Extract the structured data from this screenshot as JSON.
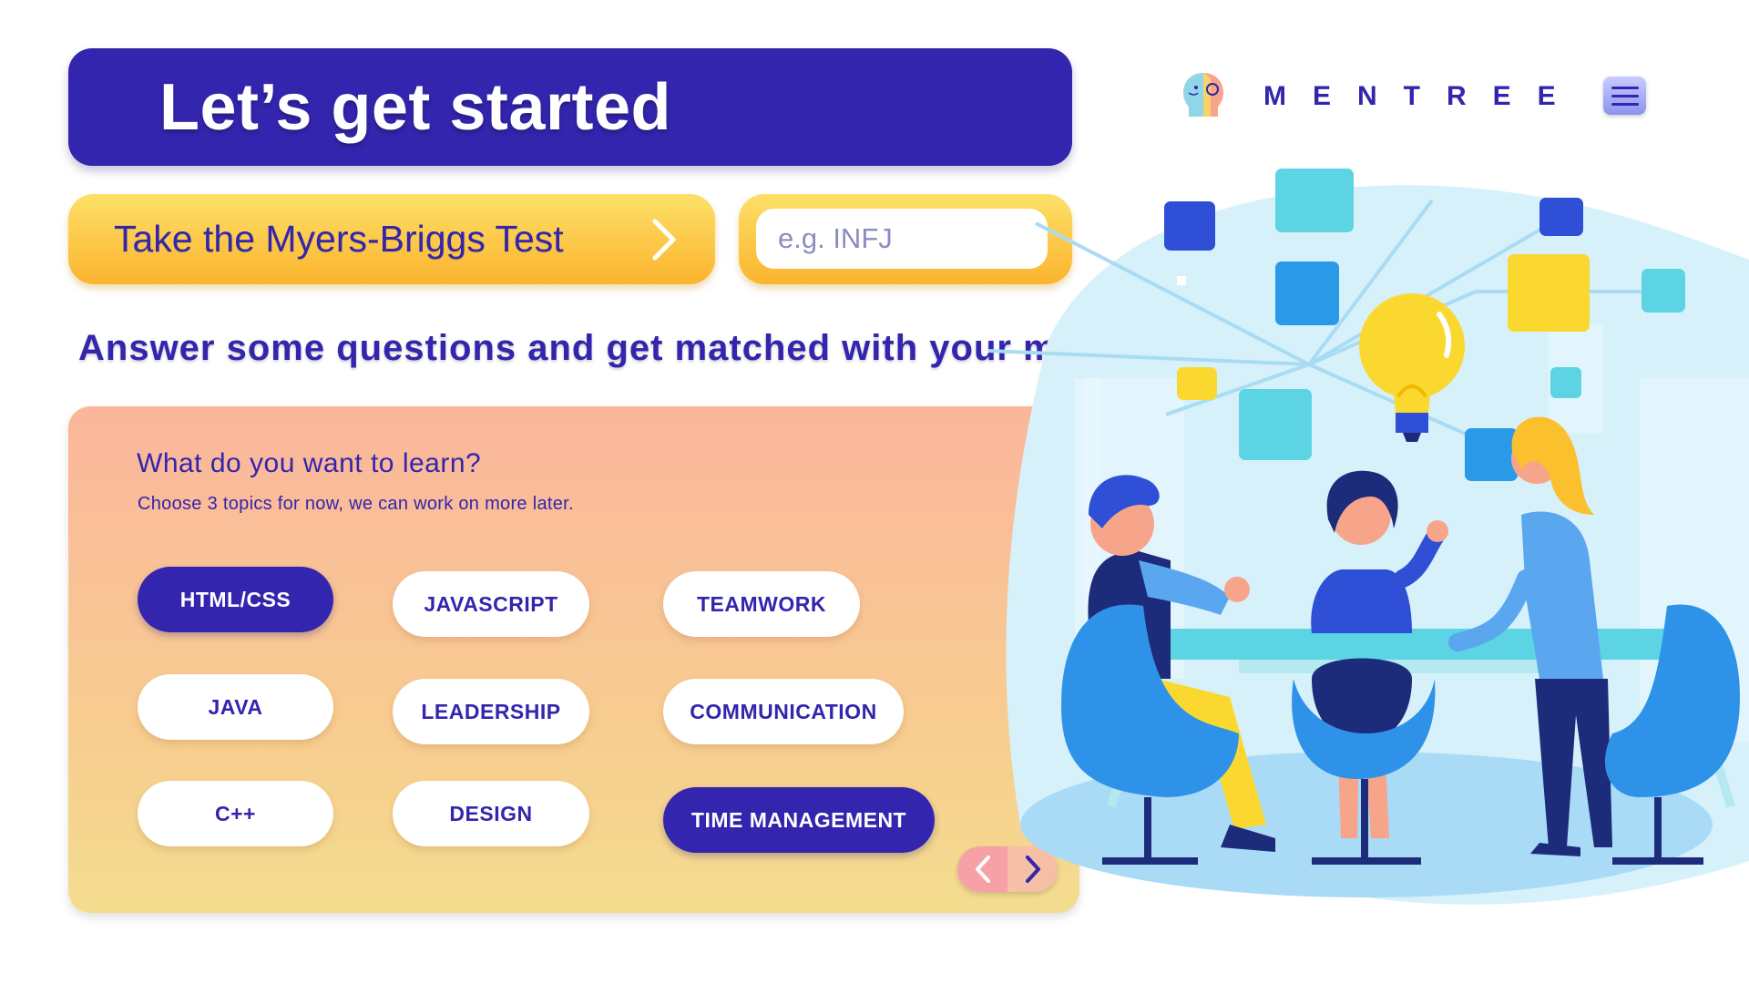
{
  "header": {
    "title": "Let’s get started"
  },
  "brand": {
    "name": "MENTREE",
    "logo_icon": "head-profile-icon",
    "menu_icon": "hamburger-menu-icon"
  },
  "mbti": {
    "button_label": "Take the Myers-Briggs Test",
    "button_icon": "chevron-right-icon",
    "input_placeholder": "e.g. INFJ",
    "input_value": ""
  },
  "tagline": "Answer some questions and get matched with your mentor!",
  "topics_panel": {
    "title": "What do you want to learn?",
    "hint": "Choose 3 topics for now, we can work on more later.",
    "topics": [
      {
        "label": "HTML/CSS",
        "selected": true
      },
      {
        "label": "JAVASCRIPT",
        "selected": false
      },
      {
        "label": "TEAMWORK",
        "selected": false
      },
      {
        "label": "JAVA",
        "selected": false
      },
      {
        "label": "LEADERSHIP",
        "selected": false
      },
      {
        "label": "COMMUNICATION",
        "selected": false
      },
      {
        "label": "C++",
        "selected": false
      },
      {
        "label": "DESIGN",
        "selected": false
      },
      {
        "label": "TIME MANAGEMENT",
        "selected": true
      }
    ],
    "pager": {
      "prev_icon": "chevron-left-icon",
      "next_icon": "chevron-right-icon"
    }
  },
  "colors": {
    "primary": "#3325ad",
    "accent_yellow": "#fbc02d",
    "panel_top": "#fbb69c",
    "panel_bottom": "#f4dd8f"
  },
  "illustration": {
    "subject": "team-meeting-lightbulb-illustration"
  }
}
